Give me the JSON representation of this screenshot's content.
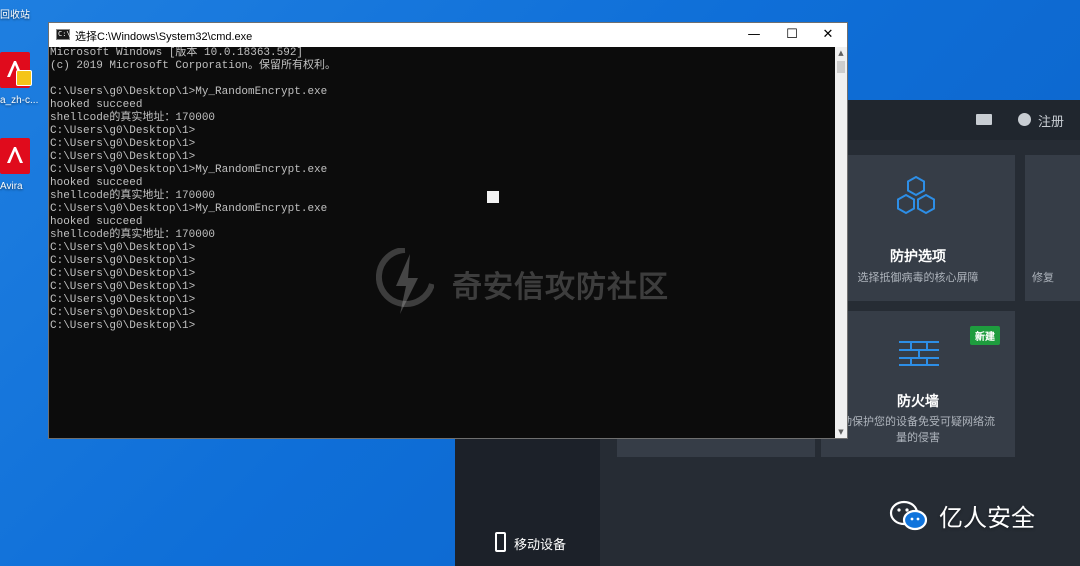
{
  "desktop": {
    "recycle_label": "回收站",
    "avira_setup_label": "a_zh-c...",
    "avira_label": "Avira"
  },
  "avira_app": {
    "register_label": "注册",
    "cards": [
      {
        "title": "防护选项",
        "desc": "选择抵御病毒的核心屏障"
      },
      {
        "title": "防火墙",
        "desc_line1": "动保护您的设备免受可疑网络流",
        "desc_line2": "量的侵害",
        "badge": "新建"
      },
      {
        "desc": "修复"
      }
    ],
    "mobile_label": "移动设备"
  },
  "cmd": {
    "title": "选择C:\\Windows\\System32\\cmd.exe",
    "icon_text": "C:\\",
    "minimize": "—",
    "maximize": "☐",
    "close": "✕",
    "lines": [
      "Microsoft Windows [版本 10.0.18363.592]",
      "(c) 2019 Microsoft Corporation。保留所有权利。",
      "",
      "C:\\Users\\g0\\Desktop\\1>My_RandomEncrypt.exe",
      "hooked succeed",
      "shellcode的真实地址：170000",
      "C:\\Users\\g0\\Desktop\\1>",
      "C:\\Users\\g0\\Desktop\\1>",
      "C:\\Users\\g0\\Desktop\\1>",
      "C:\\Users\\g0\\Desktop\\1>My_RandomEncrypt.exe",
      "hooked succeed",
      "shellcode的真实地址：170000",
      "C:\\Users\\g0\\Desktop\\1>My_RandomEncrypt.exe",
      "hooked succeed",
      "shellcode的真实地址：170000",
      "C:\\Users\\g0\\Desktop\\1>",
      "C:\\Users\\g0\\Desktop\\1>",
      "C:\\Users\\g0\\Desktop\\1>",
      "C:\\Users\\g0\\Desktop\\1>",
      "C:\\Users\\g0\\Desktop\\1>",
      "C:\\Users\\g0\\Desktop\\1>",
      "C:\\Users\\g0\\Desktop\\1>"
    ]
  },
  "watermarks": {
    "center_text": "奇安信攻防社区",
    "wechat_text": "亿人安全"
  },
  "colors": {
    "desktop_blue": "#1074dc",
    "cmd_bg": "#0c0c0c",
    "cmd_text": "#c0c0c0",
    "avira_red": "#e00b1c",
    "badge_green": "#1e9c3e",
    "accent_blue": "#2d8ee6"
  }
}
